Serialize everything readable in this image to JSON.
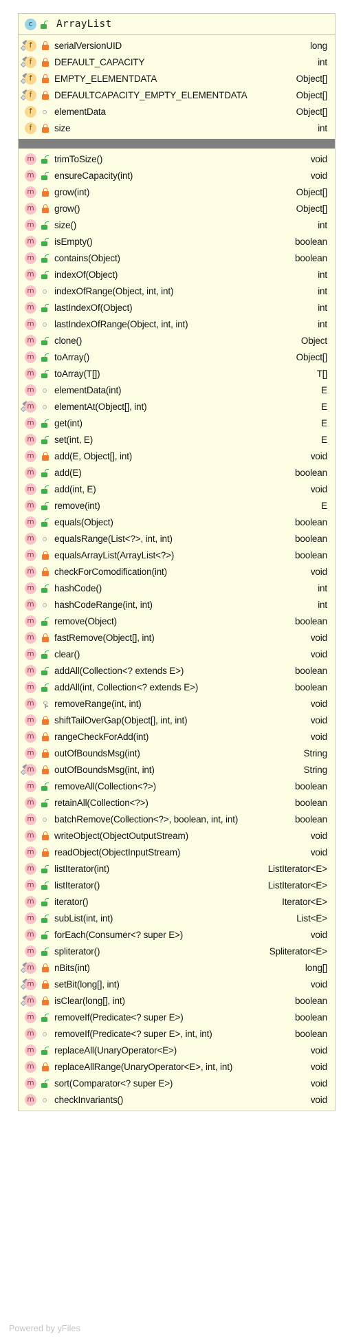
{
  "diagram": {
    "kind": "uml-class-diagram",
    "watermark": "Powered by yFiles",
    "colors": {
      "class_box_bg": "#fdfde4",
      "class_box_border": "#c9c9b4",
      "divider": "#808080",
      "class_icon": "#9ad3e6",
      "field_icon": "#fad88e",
      "method_icon": "#f7c3c8",
      "private_lock": "#f4792b",
      "public_lock": "#3faf4a",
      "package_mark": "#a6adb5",
      "protected_key": "#9aa1a9",
      "text": "#131313",
      "watermark": "#c3c3c3"
    }
  },
  "class_node": {
    "name": "ArrayList",
    "kind_icon": "class-icon",
    "kind_letter": "c",
    "visibility": "public",
    "visibility_icon": "unlock-icon"
  },
  "fields": [
    {
      "icon": "field-icon",
      "letter": "f",
      "static": true,
      "visibility": "private",
      "name": "serialVersionUID",
      "type": "long"
    },
    {
      "icon": "field-icon",
      "letter": "f",
      "static": true,
      "visibility": "private",
      "name": "DEFAULT_CAPACITY",
      "type": "int"
    },
    {
      "icon": "field-icon",
      "letter": "f",
      "static": true,
      "visibility": "private",
      "name": "EMPTY_ELEMENTDATA",
      "type": "Object[]"
    },
    {
      "icon": "field-icon",
      "letter": "f",
      "static": true,
      "visibility": "private",
      "name": "DEFAULTCAPACITY_EMPTY_ELEMENTDATA",
      "type": "Object[]"
    },
    {
      "icon": "field-icon",
      "letter": "f",
      "static": false,
      "visibility": "package",
      "name": "elementData",
      "type": "Object[]"
    },
    {
      "icon": "field-icon",
      "letter": "f",
      "static": false,
      "visibility": "private",
      "name": "size",
      "type": "int"
    }
  ],
  "methods": [
    {
      "icon": "method-icon",
      "letter": "m",
      "static": false,
      "visibility": "public",
      "name": "trimToSize()",
      "type": "void"
    },
    {
      "icon": "method-icon",
      "letter": "m",
      "static": false,
      "visibility": "public",
      "name": "ensureCapacity(int)",
      "type": "void"
    },
    {
      "icon": "method-icon",
      "letter": "m",
      "static": false,
      "visibility": "private",
      "name": "grow(int)",
      "type": "Object[]"
    },
    {
      "icon": "method-icon",
      "letter": "m",
      "static": false,
      "visibility": "private",
      "name": "grow()",
      "type": "Object[]"
    },
    {
      "icon": "method-icon",
      "letter": "m",
      "static": false,
      "visibility": "public",
      "name": "size()",
      "type": "int"
    },
    {
      "icon": "method-icon",
      "letter": "m",
      "static": false,
      "visibility": "public",
      "name": "isEmpty()",
      "type": "boolean"
    },
    {
      "icon": "method-icon",
      "letter": "m",
      "static": false,
      "visibility": "public",
      "name": "contains(Object)",
      "type": "boolean"
    },
    {
      "icon": "method-icon",
      "letter": "m",
      "static": false,
      "visibility": "public",
      "name": "indexOf(Object)",
      "type": "int"
    },
    {
      "icon": "method-icon",
      "letter": "m",
      "static": false,
      "visibility": "package",
      "name": "indexOfRange(Object, int, int)",
      "type": "int"
    },
    {
      "icon": "method-icon",
      "letter": "m",
      "static": false,
      "visibility": "public",
      "name": "lastIndexOf(Object)",
      "type": "int"
    },
    {
      "icon": "method-icon",
      "letter": "m",
      "static": false,
      "visibility": "package",
      "name": "lastIndexOfRange(Object, int, int)",
      "type": "int"
    },
    {
      "icon": "method-icon",
      "letter": "m",
      "static": false,
      "visibility": "public",
      "name": "clone()",
      "type": "Object"
    },
    {
      "icon": "method-icon",
      "letter": "m",
      "static": false,
      "visibility": "public",
      "name": "toArray()",
      "type": "Object[]"
    },
    {
      "icon": "method-icon",
      "letter": "m",
      "static": false,
      "visibility": "public",
      "name": "toArray(T[])",
      "type": "T[]"
    },
    {
      "icon": "method-icon",
      "letter": "m",
      "static": false,
      "visibility": "package",
      "name": "elementData(int)",
      "type": "E"
    },
    {
      "icon": "method-icon",
      "letter": "m",
      "static": true,
      "visibility": "package",
      "name": "elementAt(Object[], int)",
      "type": "E"
    },
    {
      "icon": "method-icon",
      "letter": "m",
      "static": false,
      "visibility": "public",
      "name": "get(int)",
      "type": "E"
    },
    {
      "icon": "method-icon",
      "letter": "m",
      "static": false,
      "visibility": "public",
      "name": "set(int, E)",
      "type": "E"
    },
    {
      "icon": "method-icon",
      "letter": "m",
      "static": false,
      "visibility": "private",
      "name": "add(E, Object[], int)",
      "type": "void"
    },
    {
      "icon": "method-icon",
      "letter": "m",
      "static": false,
      "visibility": "public",
      "name": "add(E)",
      "type": "boolean"
    },
    {
      "icon": "method-icon",
      "letter": "m",
      "static": false,
      "visibility": "public",
      "name": "add(int, E)",
      "type": "void"
    },
    {
      "icon": "method-icon",
      "letter": "m",
      "static": false,
      "visibility": "public",
      "name": "remove(int)",
      "type": "E"
    },
    {
      "icon": "method-icon",
      "letter": "m",
      "static": false,
      "visibility": "public",
      "name": "equals(Object)",
      "type": "boolean"
    },
    {
      "icon": "method-icon",
      "letter": "m",
      "static": false,
      "visibility": "package",
      "name": "equalsRange(List<?>, int, int)",
      "type": "boolean"
    },
    {
      "icon": "method-icon",
      "letter": "m",
      "static": false,
      "visibility": "private",
      "name": "equalsArrayList(ArrayList<?>)",
      "type": "boolean"
    },
    {
      "icon": "method-icon",
      "letter": "m",
      "static": false,
      "visibility": "private",
      "name": "checkForComodification(int)",
      "type": "void"
    },
    {
      "icon": "method-icon",
      "letter": "m",
      "static": false,
      "visibility": "public",
      "name": "hashCode()",
      "type": "int"
    },
    {
      "icon": "method-icon",
      "letter": "m",
      "static": false,
      "visibility": "package",
      "name": "hashCodeRange(int, int)",
      "type": "int"
    },
    {
      "icon": "method-icon",
      "letter": "m",
      "static": false,
      "visibility": "public",
      "name": "remove(Object)",
      "type": "boolean"
    },
    {
      "icon": "method-icon",
      "letter": "m",
      "static": false,
      "visibility": "private",
      "name": "fastRemove(Object[], int)",
      "type": "void"
    },
    {
      "icon": "method-icon",
      "letter": "m",
      "static": false,
      "visibility": "public",
      "name": "clear()",
      "type": "void"
    },
    {
      "icon": "method-icon",
      "letter": "m",
      "static": false,
      "visibility": "public",
      "name": "addAll(Collection<? extends E>)",
      "type": "boolean"
    },
    {
      "icon": "method-icon",
      "letter": "m",
      "static": false,
      "visibility": "public",
      "name": "addAll(int, Collection<? extends E>)",
      "type": "boolean"
    },
    {
      "icon": "method-icon",
      "letter": "m",
      "static": false,
      "visibility": "protected",
      "name": "removeRange(int, int)",
      "type": "void"
    },
    {
      "icon": "method-icon",
      "letter": "m",
      "static": false,
      "visibility": "private",
      "name": "shiftTailOverGap(Object[], int, int)",
      "type": "void"
    },
    {
      "icon": "method-icon",
      "letter": "m",
      "static": false,
      "visibility": "private",
      "name": "rangeCheckForAdd(int)",
      "type": "void"
    },
    {
      "icon": "method-icon",
      "letter": "m",
      "static": false,
      "visibility": "private",
      "name": "outOfBoundsMsg(int)",
      "type": "String"
    },
    {
      "icon": "method-icon",
      "letter": "m",
      "static": true,
      "visibility": "private",
      "name": "outOfBoundsMsg(int, int)",
      "type": "String"
    },
    {
      "icon": "method-icon",
      "letter": "m",
      "static": false,
      "visibility": "public",
      "name": "removeAll(Collection<?>)",
      "type": "boolean"
    },
    {
      "icon": "method-icon",
      "letter": "m",
      "static": false,
      "visibility": "public",
      "name": "retainAll(Collection<?>)",
      "type": "boolean"
    },
    {
      "icon": "method-icon",
      "letter": "m",
      "static": false,
      "visibility": "package",
      "name": "batchRemove(Collection<?>, boolean, int, int)",
      "type": "boolean"
    },
    {
      "icon": "method-icon",
      "letter": "m",
      "static": false,
      "visibility": "private",
      "name": "writeObject(ObjectOutputStream)",
      "type": "void"
    },
    {
      "icon": "method-icon",
      "letter": "m",
      "static": false,
      "visibility": "private",
      "name": "readObject(ObjectInputStream)",
      "type": "void"
    },
    {
      "icon": "method-icon",
      "letter": "m",
      "static": false,
      "visibility": "public",
      "name": "listIterator(int)",
      "type": "ListIterator<E>"
    },
    {
      "icon": "method-icon",
      "letter": "m",
      "static": false,
      "visibility": "public",
      "name": "listIterator()",
      "type": "ListIterator<E>"
    },
    {
      "icon": "method-icon",
      "letter": "m",
      "static": false,
      "visibility": "public",
      "name": "iterator()",
      "type": "Iterator<E>"
    },
    {
      "icon": "method-icon",
      "letter": "m",
      "static": false,
      "visibility": "public",
      "name": "subList(int, int)",
      "type": "List<E>"
    },
    {
      "icon": "method-icon",
      "letter": "m",
      "static": false,
      "visibility": "public",
      "name": "forEach(Consumer<? super E>)",
      "type": "void"
    },
    {
      "icon": "method-icon",
      "letter": "m",
      "static": false,
      "visibility": "public",
      "name": "spliterator()",
      "type": "Spliterator<E>"
    },
    {
      "icon": "method-icon",
      "letter": "m",
      "static": true,
      "visibility": "private",
      "name": "nBits(int)",
      "type": "long[]"
    },
    {
      "icon": "method-icon",
      "letter": "m",
      "static": true,
      "visibility": "private",
      "name": "setBit(long[], int)",
      "type": "void"
    },
    {
      "icon": "method-icon",
      "letter": "m",
      "static": true,
      "visibility": "private",
      "name": "isClear(long[], int)",
      "type": "boolean"
    },
    {
      "icon": "method-icon",
      "letter": "m",
      "static": false,
      "visibility": "public",
      "name": "removeIf(Predicate<? super E>)",
      "type": "boolean"
    },
    {
      "icon": "method-icon",
      "letter": "m",
      "static": false,
      "visibility": "package",
      "name": "removeIf(Predicate<? super E>, int, int)",
      "type": "boolean"
    },
    {
      "icon": "method-icon",
      "letter": "m",
      "static": false,
      "visibility": "public",
      "name": "replaceAll(UnaryOperator<E>)",
      "type": "void"
    },
    {
      "icon": "method-icon",
      "letter": "m",
      "static": false,
      "visibility": "private",
      "name": "replaceAllRange(UnaryOperator<E>, int, int)",
      "type": "void"
    },
    {
      "icon": "method-icon",
      "letter": "m",
      "static": false,
      "visibility": "public",
      "name": "sort(Comparator<? super E>)",
      "type": "void"
    },
    {
      "icon": "method-icon",
      "letter": "m",
      "static": false,
      "visibility": "package",
      "name": "checkInvariants()",
      "type": "void"
    }
  ]
}
